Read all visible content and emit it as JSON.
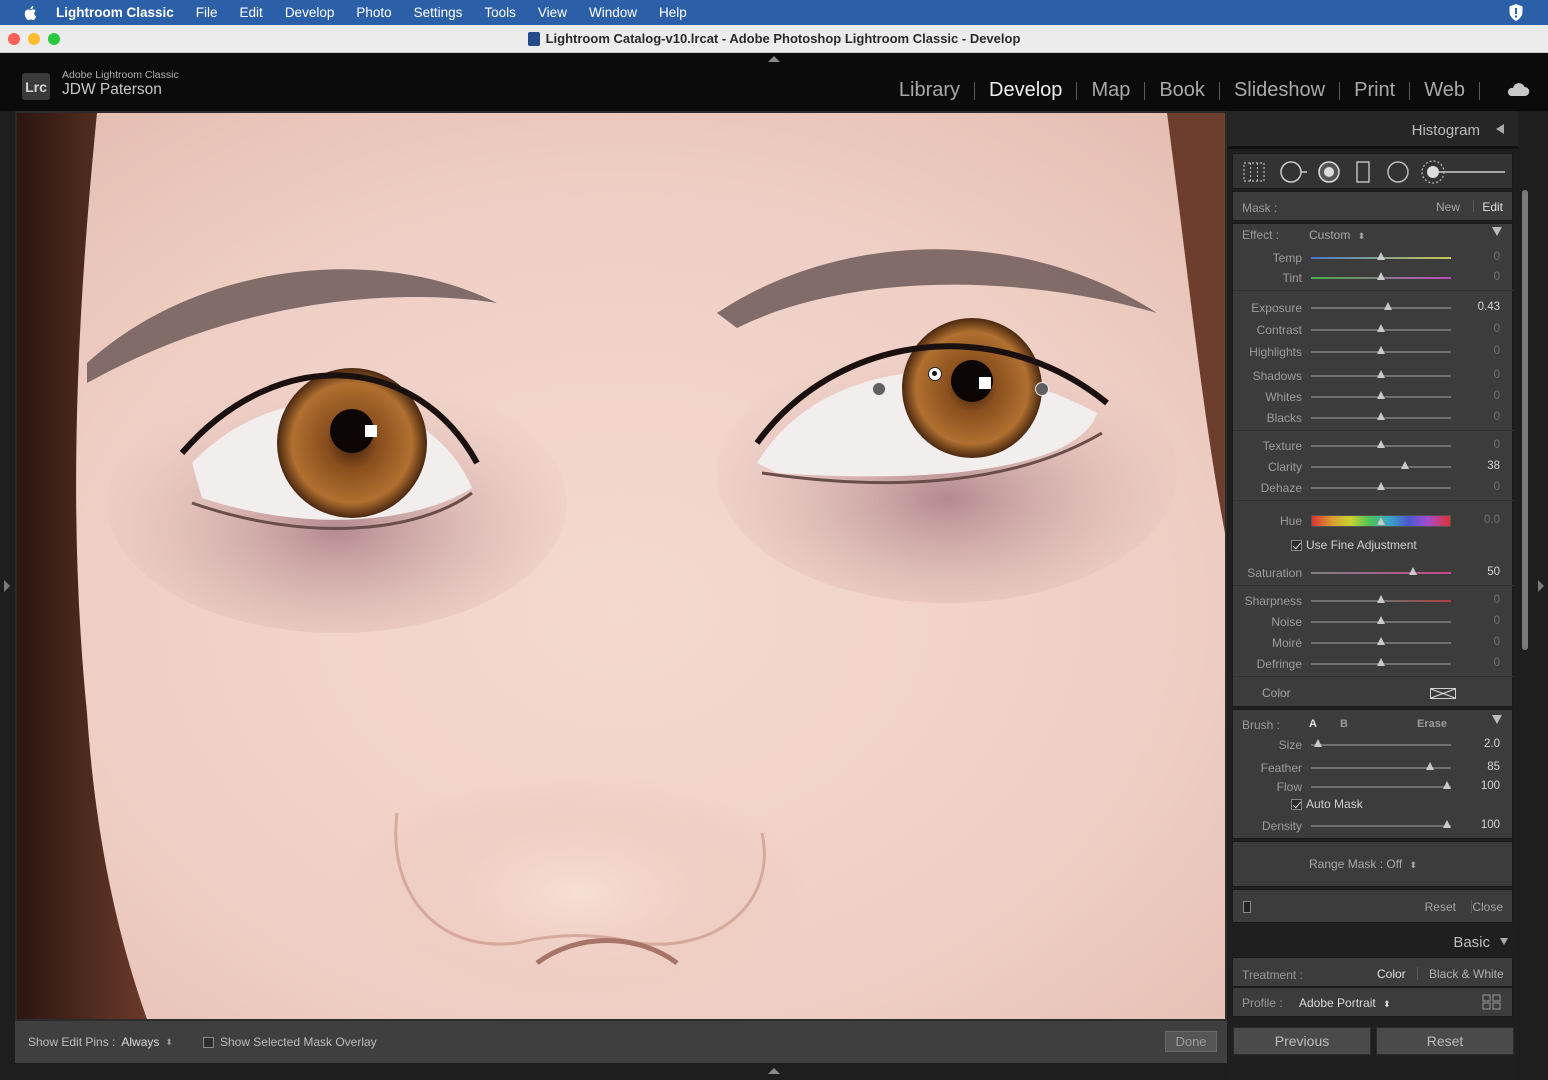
{
  "menubar": {
    "app_name": "Lightroom Classic",
    "items": [
      "File",
      "Edit",
      "Develop",
      "Photo",
      "Settings",
      "Tools",
      "View",
      "Window",
      "Help"
    ]
  },
  "window": {
    "title": "Lightroom Catalog-v10.lrcat - Adobe Photoshop Lightroom Classic - Develop"
  },
  "identity": {
    "badge": "Lrc",
    "product": "Adobe Lightroom Classic",
    "user": "JDW Paterson"
  },
  "modules": {
    "items": [
      "Library",
      "Develop",
      "Map",
      "Book",
      "Slideshow",
      "Print",
      "Web"
    ],
    "active": "Develop"
  },
  "toolbar": {
    "show_edit_pins_label": "Show Edit Pins :",
    "show_edit_pins_value": "Always",
    "updown_glyph": "⬍",
    "overlay_label": "Show Selected Mask Overlay",
    "done_label": "Done"
  },
  "panel": {
    "histogram_title": "Histogram",
    "mask": {
      "label": "Mask :",
      "new": "New",
      "edit": "Edit"
    },
    "effect": {
      "label": "Effect :",
      "value": "Custom",
      "updown": "⬍"
    },
    "sliders": {
      "temp": {
        "name": "Temp",
        "value": "0",
        "pos": 0.5
      },
      "tint": {
        "name": "Tint",
        "value": "0",
        "pos": 0.5
      },
      "exposure": {
        "name": "Exposure",
        "value": "0.43",
        "pos": 0.55
      },
      "contrast": {
        "name": "Contrast",
        "value": "0",
        "pos": 0.5
      },
      "highlights": {
        "name": "Highlights",
        "value": "0",
        "pos": 0.5
      },
      "shadows": {
        "name": "Shadows",
        "value": "0",
        "pos": 0.5
      },
      "whites": {
        "name": "Whites",
        "value": "0",
        "pos": 0.5
      },
      "blacks": {
        "name": "Blacks",
        "value": "0",
        "pos": 0.5
      },
      "texture": {
        "name": "Texture",
        "value": "0",
        "pos": 0.5
      },
      "clarity": {
        "name": "Clarity",
        "value": "38",
        "pos": 0.67
      },
      "dehaze": {
        "name": "Dehaze",
        "value": "0",
        "pos": 0.5
      },
      "hue": {
        "name": "Hue",
        "value": "0.0",
        "pos": 0.5
      },
      "saturation": {
        "name": "Saturation",
        "value": "50",
        "pos": 0.73
      },
      "sharpness": {
        "name": "Sharpness",
        "value": "0",
        "pos": 0.5
      },
      "noise": {
        "name": "Noise",
        "value": "0",
        "pos": 0.5
      },
      "moire": {
        "name": "Moiré",
        "value": "0",
        "pos": 0.5
      },
      "defringe": {
        "name": "Defringe",
        "value": "0",
        "pos": 0.5
      }
    },
    "use_fine_adjustment": "Use Fine Adjustment",
    "color_label": "Color",
    "brush": {
      "label": "Brush :",
      "a": "A",
      "b": "B",
      "erase": "Erase",
      "size": {
        "name": "Size",
        "value": "2.0",
        "pos": 0.05
      },
      "feather": {
        "name": "Feather",
        "value": "85",
        "pos": 0.85
      },
      "flow": {
        "name": "Flow",
        "value": "100",
        "pos": 0.97
      },
      "auto_mask": "Auto Mask",
      "density": {
        "name": "Density",
        "value": "100",
        "pos": 0.97
      }
    },
    "range_mask": "Range Mask : Off",
    "range_updown": "⬍",
    "reset": "Reset",
    "close": "Close",
    "basic_title": "Basic",
    "treatment": {
      "label": "Treatment :",
      "color": "Color",
      "bw": "Black & White"
    },
    "profile": {
      "label": "Profile :",
      "value": "Adobe Portrait",
      "updown": "⬍"
    },
    "previous_button": "Previous",
    "reset_button": "Reset"
  },
  "colors": {
    "menubar": "#2b5fa8",
    "panel": "#3c3c3c",
    "active_module": "#f0f0f0"
  }
}
